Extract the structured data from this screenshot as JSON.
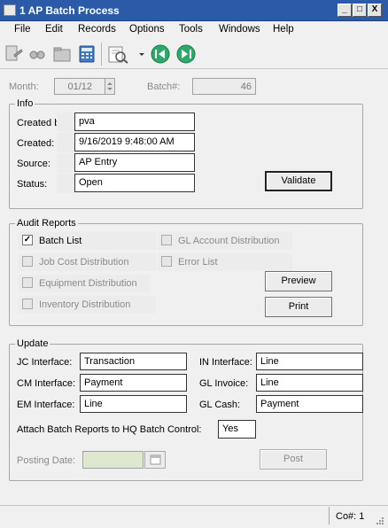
{
  "window": {
    "title": "1 AP Batch Process"
  },
  "title_buttons": {
    "minimize": "_",
    "maximize": "□",
    "close": "X"
  },
  "menu": [
    "File",
    "Edit",
    "Records",
    "Options",
    "Tools",
    "Windows",
    "Help"
  ],
  "toolbar": {
    "icons": [
      "new-record-icon",
      "find-icon",
      "folder-icon",
      "calculator-icon",
      "print-preview-icon",
      "dropdown-arrow-icon",
      "previous-record-icon",
      "next-record-icon"
    ]
  },
  "header": {
    "month_label": "Month:",
    "month_value": "01/12",
    "batch_label": "Batch#:",
    "batch_value": "46"
  },
  "info": {
    "title": "Info",
    "created_by_label": "Created by:",
    "created_by_value": "pva",
    "created_label": "Created:",
    "created_value": "9/16/2019 9:48:00 AM",
    "source_label": "Source:",
    "source_value": "AP Entry",
    "status_label": "Status:",
    "status_value": "Open",
    "validate_label": "Validate"
  },
  "audit": {
    "title": "Audit Reports",
    "batch_list": {
      "label": "Batch List",
      "checked": true
    },
    "gl_account": {
      "label": "GL Account Distribution",
      "checked": false
    },
    "job_cost": {
      "label": "Job Cost Distribution",
      "checked": false
    },
    "error_list": {
      "label": "Error List",
      "checked": false
    },
    "equipment": {
      "label": "Equipment Distribution",
      "checked": false
    },
    "inventory": {
      "label": "Inventory Distribution",
      "checked": false
    },
    "preview_label": "Preview",
    "print_label": "Print"
  },
  "update": {
    "title": "Update",
    "jc_label": "JC Interface:",
    "jc_value": "Transaction",
    "in_label": "IN Interface:",
    "in_value": "Line",
    "cm_label": "CM Interface:",
    "cm_value": "Payment",
    "gl_invoice_label": "GL Invoice:",
    "gl_invoice_value": "Line",
    "em_label": "EM Interface:",
    "em_value": "Line",
    "gl_cash_label": "GL Cash:",
    "gl_cash_value": "Payment",
    "attach_label": "Attach Batch Reports to HQ Batch Control:",
    "attach_value": "Yes",
    "posting_date_label": "Posting Date:",
    "posting_date_value": "",
    "post_label": "Post"
  },
  "statusbar": {
    "company": "Co#: 1"
  }
}
